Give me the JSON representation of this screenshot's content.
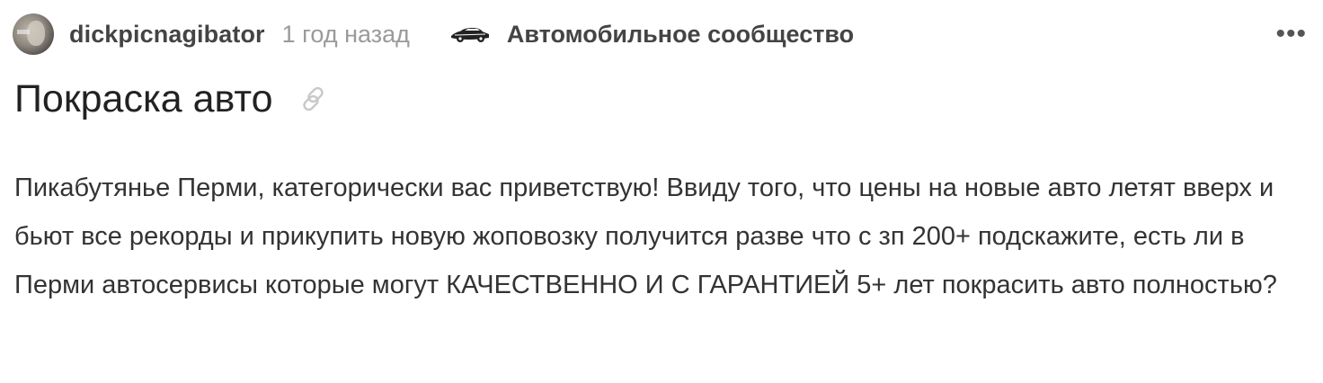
{
  "post": {
    "author": "dickpicnagibator",
    "time_ago": "1 год назад",
    "community": "Автомобильное сообщество",
    "more_label": "•••",
    "title": "Покраска авто",
    "body": "Пикабутянье Перми, категорически вас приветствую! Ввиду того, что цены на новые авто летят вверх и бьют все рекорды и прикупить новую жоповозку получится разве что с зп 200+ подскажите, есть ли в Перми автосервисы которые могут КАЧЕСТВЕННО И С ГАРАНТИЕЙ 5+ лет покрасить авто полностью?"
  },
  "icons": {
    "avatar": "user-avatar",
    "community": "car-icon",
    "link": "link-icon",
    "more": "more-dots-icon"
  },
  "colors": {
    "text": "#333333",
    "muted": "#9a9a9a",
    "title": "#222222"
  }
}
